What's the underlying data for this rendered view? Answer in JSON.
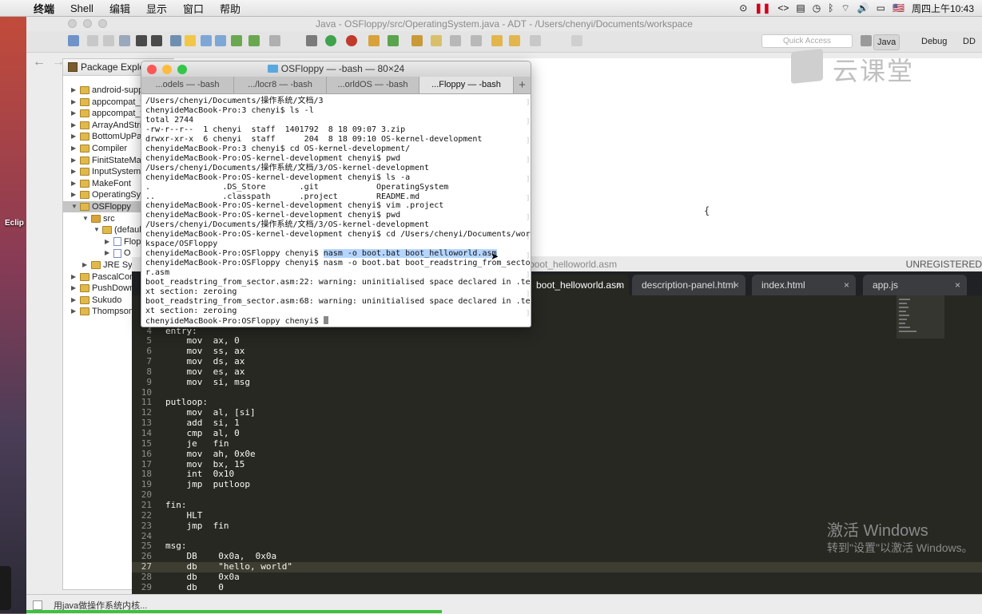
{
  "menubar": {
    "items": [
      "终端",
      "Shell",
      "编辑",
      "显示",
      "窗口",
      "帮助"
    ],
    "flag": "🇺🇸",
    "clock": "周四上午10:43"
  },
  "desktop": {
    "eclipse_label": "Eclip"
  },
  "adt": {
    "title": "Java - OSFloppy/src/OperatingSystem.java - ADT - /Users/chenyi/Documents/workspace",
    "quick_access": "Quick Access",
    "perspectives": [
      "Java",
      "Debug",
      "DD"
    ],
    "package_explorer": {
      "title": "Package Explor",
      "items": [
        {
          "label": "android-supp",
          "depth": 0,
          "kind": "project",
          "twisty": "closed"
        },
        {
          "label": "appcompat_v",
          "depth": 0,
          "kind": "project",
          "twisty": "closed"
        },
        {
          "label": "appcompat_v",
          "depth": 0,
          "kind": "project",
          "twisty": "closed"
        },
        {
          "label": "ArrayAndStri",
          "depth": 0,
          "kind": "project",
          "twisty": "closed"
        },
        {
          "label": "BottomUpPar",
          "depth": 0,
          "kind": "project",
          "twisty": "closed"
        },
        {
          "label": "Compiler",
          "depth": 0,
          "kind": "project",
          "twisty": "closed"
        },
        {
          "label": "FinitStateMa",
          "depth": 0,
          "kind": "project",
          "twisty": "closed"
        },
        {
          "label": "InputSystem",
          "depth": 0,
          "kind": "project",
          "twisty": "closed"
        },
        {
          "label": "MakeFont",
          "depth": 0,
          "kind": "project",
          "twisty": "closed"
        },
        {
          "label": "OperatingSys",
          "depth": 0,
          "kind": "project",
          "twisty": "closed"
        },
        {
          "label": "OSFloppy",
          "depth": 0,
          "kind": "project",
          "twisty": "open",
          "selected": true
        },
        {
          "label": "src",
          "depth": 1,
          "kind": "src",
          "twisty": "open"
        },
        {
          "label": "(defaul",
          "depth": 2,
          "kind": "package",
          "twisty": "open"
        },
        {
          "label": "Flop",
          "depth": 3,
          "kind": "java",
          "twisty": "closed"
        },
        {
          "label": "O",
          "depth": 3,
          "kind": "java",
          "twisty": "closed"
        },
        {
          "label": "JRE Sys",
          "depth": 1,
          "kind": "library",
          "twisty": "closed"
        },
        {
          "label": "PascalCom",
          "depth": 0,
          "kind": "project",
          "twisty": "closed"
        },
        {
          "label": "PushDown",
          "depth": 0,
          "kind": "project",
          "twisty": "closed"
        },
        {
          "label": "Sukudo",
          "depth": 0,
          "kind": "project",
          "twisty": "closed"
        },
        {
          "label": "Thompson",
          "depth": 0,
          "kind": "project",
          "twisty": "closed"
        }
      ]
    },
    "editor_fragment": "{"
  },
  "watermark": {
    "text": "云课堂"
  },
  "terminal": {
    "title": "OSFloppy — -bash — 80×24",
    "tabs": [
      "...odels — -bash",
      ".../locr8 — -bash",
      "...orldOS — -bash",
      "...Floppy — -bash"
    ],
    "active_tab": 3,
    "lines": [
      "/Users/chenyi/Documents/操作系统/文档/3",
      "chenyideMacBook-Pro:3 chenyi$ ls -l",
      "total 2744",
      "-rw-r--r--  1 chenyi  staff  1401792  8 18 09:07 3.zip",
      "drwxr-xr-x  6 chenyi  staff      204  8 18 09:10 OS-kernel-development",
      "chenyideMacBook-Pro:3 chenyi$ cd OS-kernel-development/",
      "chenyideMacBook-Pro:OS-kernel-development chenyi$ pwd",
      "/Users/chenyi/Documents/操作系统/文档/3/OS-kernel-development",
      "chenyideMacBook-Pro:OS-kernel-development chenyi$ ls -a",
      ".               .DS_Store       .git            OperatingSystem",
      "..              .classpath      .project        README.md",
      "chenyideMacBook-Pro:OS-kernel-development chenyi$ vim .project",
      "chenyideMacBook-Pro:OS-kernel-development chenyi$ pwd",
      "/Users/chenyi/Documents/操作系统/文档/3/OS-kernel-development",
      "chenyideMacBook-Pro:OS-kernel-development chenyi$ cd /Users/chenyi/Documents/wor",
      "kspace/OSFloppy",
      "chenyideMacBook-Pro:OSFloppy chenyi$ ",
      "chenyideMacBook-Pro:OSFloppy chenyi$ nasm -o boot.bat boot_readstring_from_secto",
      "r.asm",
      "boot_readstring_from_sector.asm:22: warning: uninitialised space declared in .te",
      "xt section: zeroing",
      "boot_readstring_from_sector.asm:68: warning: uninitialised space declared in .te",
      "xt section: zeroing",
      "chenyideMacBook-Pro:OSFloppy chenyi$ "
    ],
    "highlighted_command": "nasm -o boot.bat boot_helloworld.asm"
  },
  "sublime": {
    "title": "boot_helloworld.asm",
    "unregistered": "UNREGISTERED",
    "tabs": [
      "boot_helloworld.asm",
      "description-panel.html",
      "index.html",
      "app.js"
    ],
    "active_tab": 0,
    "current_line": 27,
    "lines": [
      {
        "n": "4",
        "t": "entry:"
      },
      {
        "n": "5",
        "t": "    mov  ax, 0"
      },
      {
        "n": "6",
        "t": "    mov  ss, ax"
      },
      {
        "n": "7",
        "t": "    mov  ds, ax"
      },
      {
        "n": "8",
        "t": "    mov  es, ax"
      },
      {
        "n": "9",
        "t": "    mov  si, msg"
      },
      {
        "n": "10",
        "t": ""
      },
      {
        "n": "11",
        "t": "putloop:"
      },
      {
        "n": "12",
        "t": "    mov  al, [si]"
      },
      {
        "n": "13",
        "t": "    add  si, 1"
      },
      {
        "n": "14",
        "t": "    cmp  al, 0"
      },
      {
        "n": "15",
        "t": "    je   fin"
      },
      {
        "n": "16",
        "t": "    mov  ah, 0x0e"
      },
      {
        "n": "17",
        "t": "    mov  bx, 15"
      },
      {
        "n": "18",
        "t": "    int  0x10"
      },
      {
        "n": "19",
        "t": "    jmp  putloop"
      },
      {
        "n": "20",
        "t": ""
      },
      {
        "n": "21",
        "t": "fin:"
      },
      {
        "n": "22",
        "t": "    HLT"
      },
      {
        "n": "23",
        "t": "    jmp  fin"
      },
      {
        "n": "24",
        "t": ""
      },
      {
        "n": "25",
        "t": "msg:"
      },
      {
        "n": "26",
        "t": "    DB    0x0a,  0x0a"
      },
      {
        "n": "27",
        "t": "    db    \"hello, world\""
      },
      {
        "n": "28",
        "t": "    db    0x0a"
      },
      {
        "n": "29",
        "t": "    db    0"
      }
    ]
  },
  "activation": {
    "title": "激活 Windows",
    "subtitle": "转到\"设置\"以激活 Windows。"
  },
  "taskbar": {
    "task_label": "用java做操作系统内核..."
  },
  "colors": {
    "terminal_highlight": "#b4d5fe",
    "sublime_bg": "#272822",
    "progress": "#3fbf3f"
  }
}
